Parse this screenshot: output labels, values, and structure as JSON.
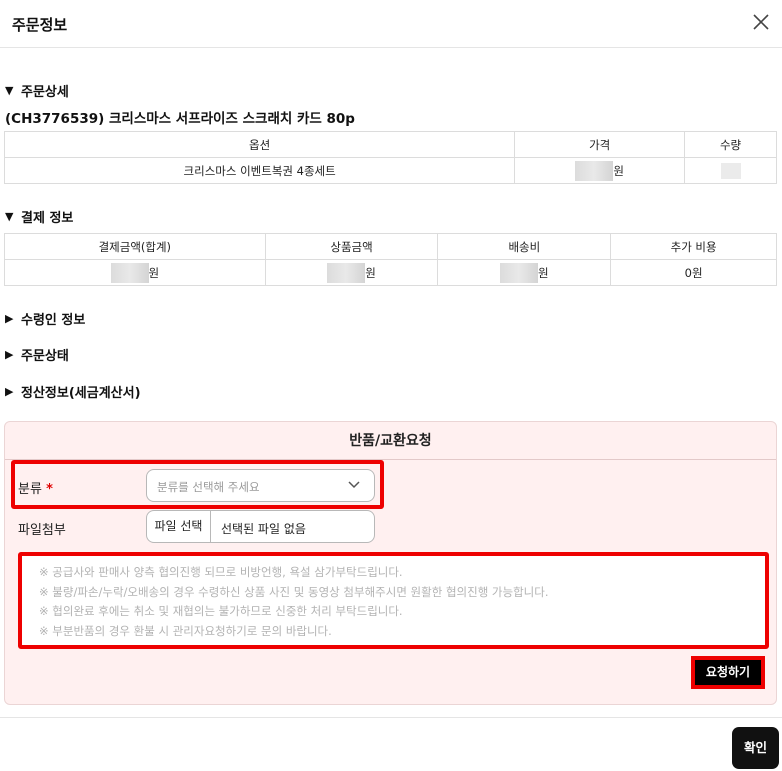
{
  "header": {
    "title": "주문정보",
    "close_icon": "close-icon"
  },
  "order_detail": {
    "heading": "주문상세",
    "product_title": "(CH3776539) 크리스마스 서프라이즈 스크래치 카드 80p",
    "columns": [
      "옵션",
      "가격",
      "수량"
    ],
    "rows": [
      {
        "option": "크리스마스 이벤트복권 4종세트",
        "price_unit": "원"
      }
    ]
  },
  "payment": {
    "heading": "결제 정보",
    "columns": [
      "결제금액(합계)",
      "상품금액",
      "배송비",
      "추가 비용"
    ],
    "unit": "원",
    "extra_cost": "0원"
  },
  "collapsed_sections": [
    "수령인 정보",
    "주문상태",
    "정산정보(세금계산서)"
  ],
  "request": {
    "title": "반품/교환요청",
    "category_label": "분류",
    "required_mark": "*",
    "category_placeholder": "분류를 선택해 주세요",
    "file_label": "파일첨부",
    "file_button": "파일 선택",
    "file_status": "선택된 파일 없음",
    "notes": [
      "※ 공급사와 판매사 양측 협의진행 되므로 비방언행, 욕설 삼가부탁드립니다.",
      "※ 불량/파손/누락/오배송의 경우 수령하신 상품 사진 및 동영상 첨부해주시면 원활한 협의진행 가능합니다.",
      "※ 협의완료 후에는 취소 및 재협의는 불가하므로 신중한 처리 부탁드립니다.",
      "※ 부분반품의 경우 환불 시 관리자요청하기로 문의 바랍니다."
    ],
    "submit_label": "요청하기"
  },
  "footer": {
    "confirm_label": "확인"
  },
  "colors": {
    "highlight": "#ee0000",
    "panel_bg": "#fff0f0",
    "primary_button": "#000000"
  }
}
